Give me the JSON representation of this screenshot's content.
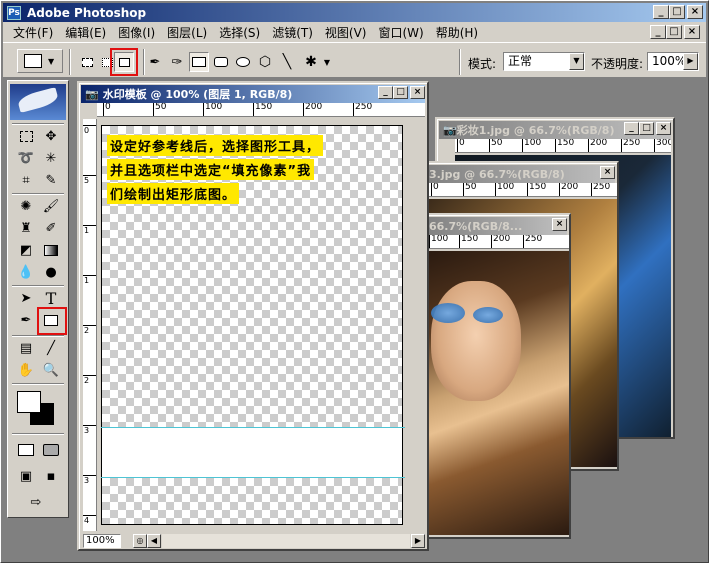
{
  "app": {
    "title": "Adobe Photoshop"
  },
  "menu": [
    "文件(F)",
    "编辑(E)",
    "图像(I)",
    "图层(L)",
    "选择(S)",
    "滤镜(T)",
    "视图(V)",
    "窗口(W)",
    "帮助(H)"
  ],
  "window_buttons": {
    "minimize": "_",
    "restore": "□",
    "close": "×"
  },
  "options_bar": {
    "mode_label": "模式:",
    "mode_value": "正常",
    "opacity_label": "不透明度:",
    "opacity_value": "100%",
    "dropdown_arrow": "▼",
    "opacity_arrow": "▶"
  },
  "documents": [
    {
      "title": "水印模板 @ 100% (图层 1, RGB/8)",
      "ruler": [
        "0",
        "50",
        "100",
        "150",
        "200",
        "250"
      ],
      "zoom": "100%"
    },
    {
      "title": "彩妆1.jpg @ 66.7%(RGB/8)",
      "ruler": [
        "0",
        "50",
        "100",
        "150",
        "200",
        "250",
        "300"
      ]
    },
    {
      "title": "3.jpg @ 66.7%(RGB/8)",
      "ruler": [
        "0",
        "50",
        "100",
        "150",
        "200",
        "250"
      ]
    },
    {
      "title": "66.7%(RGB/8...",
      "ruler": [
        "100",
        "150",
        "200",
        "250"
      ]
    }
  ],
  "caption": [
    "设定好参考线后，选择图形工具，",
    "并且选项栏中选定“填充像素”我",
    "们绘制出矩形底图。"
  ],
  "toolbox": {
    "type_tool": "T"
  },
  "colors": {
    "accent": "#0a246a",
    "highlight": "#e01010",
    "caption_bg": "#ffe800",
    "guide": "#4ec4d4"
  }
}
